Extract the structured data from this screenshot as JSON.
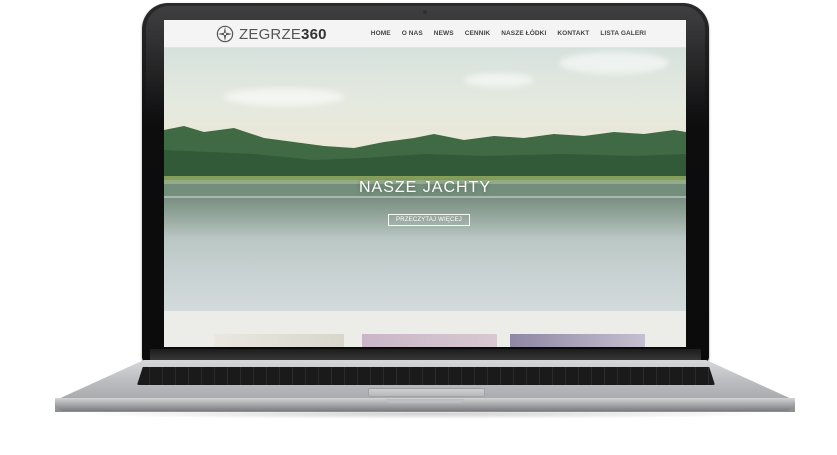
{
  "site": {
    "logo": {
      "prefix": "ZEGRZE",
      "suffix": "360",
      "icon": "compass-rose-icon"
    },
    "nav": {
      "items": [
        {
          "label": "HOME"
        },
        {
          "label": "O NAS"
        },
        {
          "label": "NEWS"
        },
        {
          "label": "CENNIK"
        },
        {
          "label": "NASZE ŁÓDKI"
        },
        {
          "label": "KONTAKT"
        },
        {
          "label": "LISTA GALERI"
        }
      ]
    },
    "hero": {
      "title": "NASZE JACHTY",
      "button_label": "PRZECZYTAJ WIĘCEJ"
    }
  },
  "colors": {
    "header_bg": "#f4f4f4",
    "nav_text": "#444444",
    "hero_text": "#ffffff",
    "laptop_bezel": "#0b0b0c",
    "laptop_base": "#bfc0c3"
  }
}
